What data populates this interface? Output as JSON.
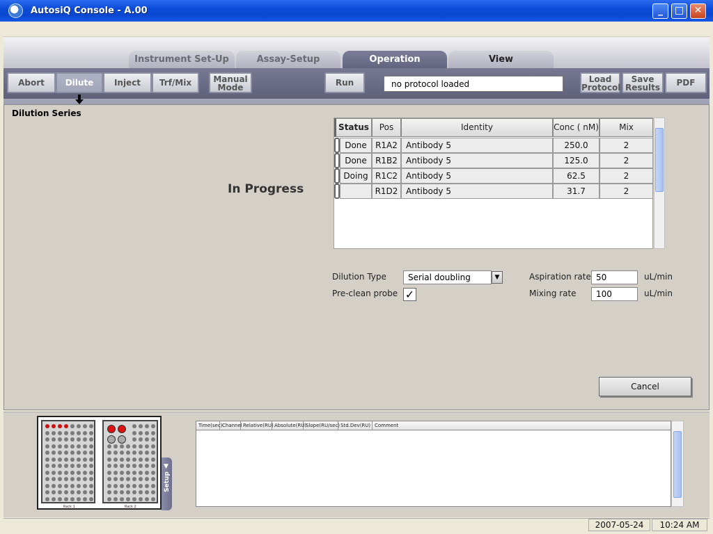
{
  "window": {
    "title": "AutosiQ Console - A.00",
    "min": "_",
    "max": "□",
    "close": "✕"
  },
  "tabs": [
    {
      "label": "Instrument Set-Up"
    },
    {
      "label": "Assay-Setup"
    },
    {
      "label": "Operation"
    },
    {
      "label": "View"
    }
  ],
  "toolbar": {
    "abort": "Abort",
    "dilute": "Dilute",
    "inject": "Inject",
    "trf_mix": "Trf/Mix",
    "manual_mode_1": "Manual",
    "manual_mode_2": "Mode",
    "run": "Run",
    "protocol_status": "no protocol loaded",
    "load_protocol_1": "Load",
    "load_protocol_2": "Protocol",
    "save_results_1": "Save",
    "save_results_2": "Results",
    "pdf": "PDF"
  },
  "section_title": "Dilution Series",
  "progress_label": "In Progress",
  "table": {
    "columns": [
      "Status",
      "Pos",
      "Identity",
      "Conc ( nM)",
      "Mix"
    ],
    "rows": [
      {
        "status": "Done",
        "pos": "R1A2",
        "identity": "Antibody 5",
        "conc": "250.0",
        "mix": "2"
      },
      {
        "status": "Done",
        "pos": "R1B2",
        "identity": "Antibody 5",
        "conc": "125.0",
        "mix": "2"
      },
      {
        "status": "Doing",
        "pos": "R1C2",
        "identity": "Antibody 5",
        "conc": "62.5",
        "mix": "2"
      },
      {
        "status": "",
        "pos": "R1D2",
        "identity": "Antibody 5",
        "conc": "31.7",
        "mix": "2"
      }
    ]
  },
  "settings": {
    "dilution_type_label": "Dilution Type",
    "dilution_type_value": "Serial doubling",
    "preclean_label": "Pre-clean probe",
    "preclean_check": "✓",
    "aspiration_label": "Aspiration rate",
    "aspiration_value": "50",
    "aspiration_unit": "uL/min",
    "mixing_label": "Mixing rate",
    "mixing_value": "100",
    "mixing_unit": "uL/min"
  },
  "cancel": "Cancel",
  "racks": {
    "rack1": "Rack 1",
    "rack2": "Rack 2",
    "setup_tab": "Setup",
    "setup_arrow": "▼"
  },
  "log": {
    "columns": [
      "Time(sec)",
      "Channel",
      "Relative(RU)",
      "Absolute(RU)",
      "Slope(RU/sec)",
      "Std.Dev(RU)",
      "Comment"
    ]
  },
  "status": {
    "date": "2007-05-24",
    "time": "10:24 AM"
  }
}
